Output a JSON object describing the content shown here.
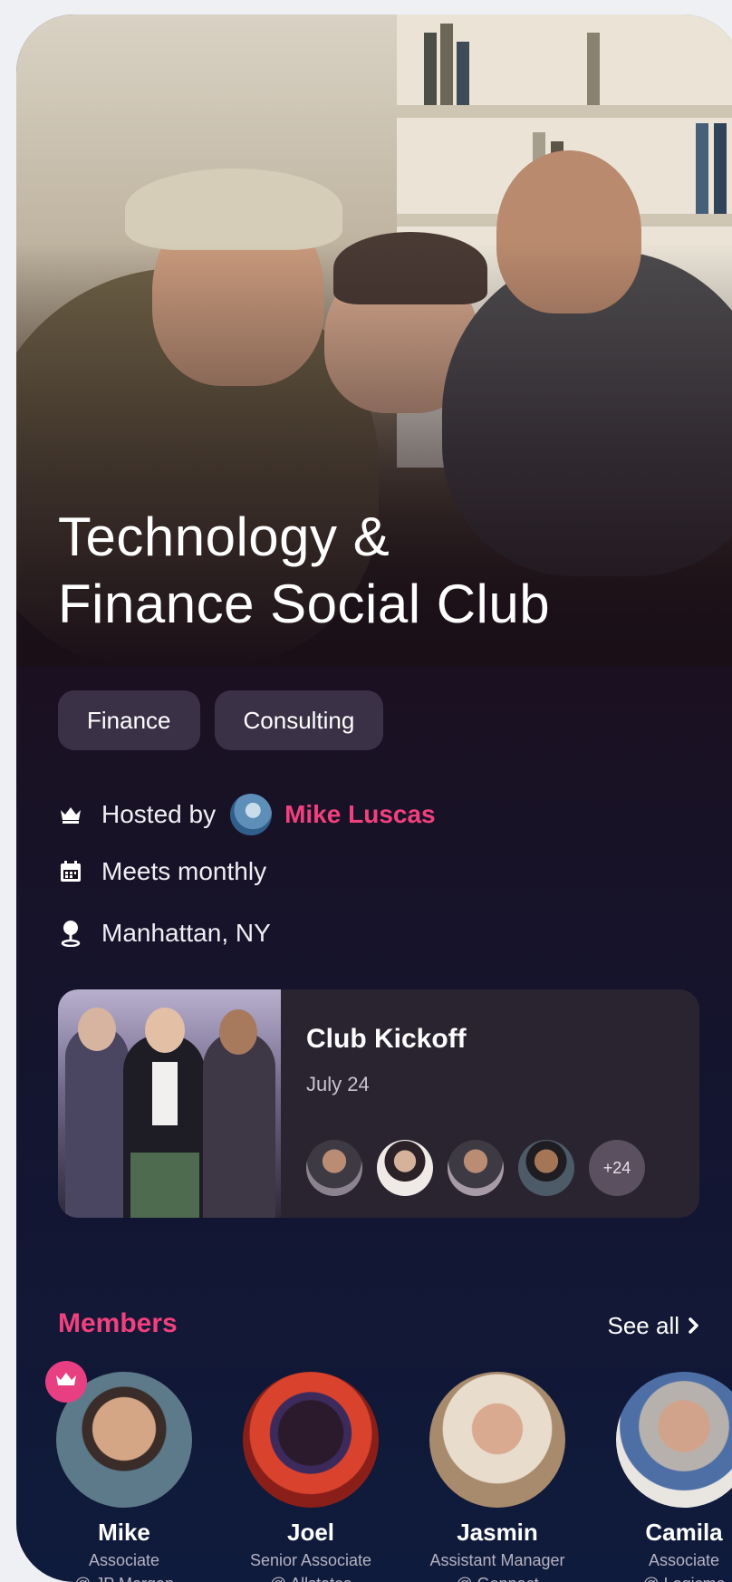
{
  "club": {
    "title_line1": "Technology &",
    "title_line2": "Finance Social Club",
    "tags": [
      "Finance",
      "Consulting"
    ],
    "hosted_by_label": "Hosted by",
    "host_name": "Mike Luscas",
    "schedule": "Meets monthly",
    "location": "Manhattan, NY"
  },
  "event": {
    "title": "Club Kickoff",
    "date": "July 24",
    "more_attendees": "+24"
  },
  "members_section": {
    "title": "Members",
    "see_all": "See all",
    "members": [
      {
        "name": "Mike",
        "role": "Associate",
        "company": "@ JP Morgan"
      },
      {
        "name": "Joel",
        "role": "Senior Associate",
        "company": "@ Allstates"
      },
      {
        "name": "Jasmin",
        "role": "Assistant Manager",
        "company": "@ Genpact"
      },
      {
        "name": "Camila",
        "role": "Associate",
        "company": "@ Logicmo"
      }
    ]
  },
  "colors": {
    "accent_pink": "#f2407e",
    "tag_bg": "#3a3147",
    "card_bg": "#2a2430"
  },
  "icons": {
    "host": "crown-icon",
    "schedule": "calendar-icon",
    "location": "map-pin-icon",
    "see_all": "chevron-right-icon",
    "owner_badge": "crown-icon"
  }
}
